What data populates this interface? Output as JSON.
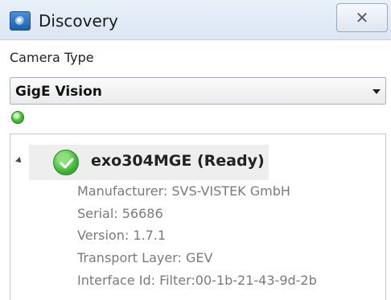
{
  "window": {
    "title": "Discovery",
    "close_glyph": "✕",
    "icon": "app-icon"
  },
  "camera_type": {
    "label": "Camera Type",
    "selected": "GigE Vision"
  },
  "status": {
    "led_color": "#3fbf33"
  },
  "device": {
    "name": "exo304MGE (Ready)",
    "status_color": "#3db536",
    "details": [
      "Manufacturer: SVS-VISTEK GmbH",
      "Serial: 56686",
      "Version: 1.7.1",
      "Transport Layer: GEV",
      "Interface Id: Filter:00-1b-21-43-9d-2b"
    ]
  }
}
